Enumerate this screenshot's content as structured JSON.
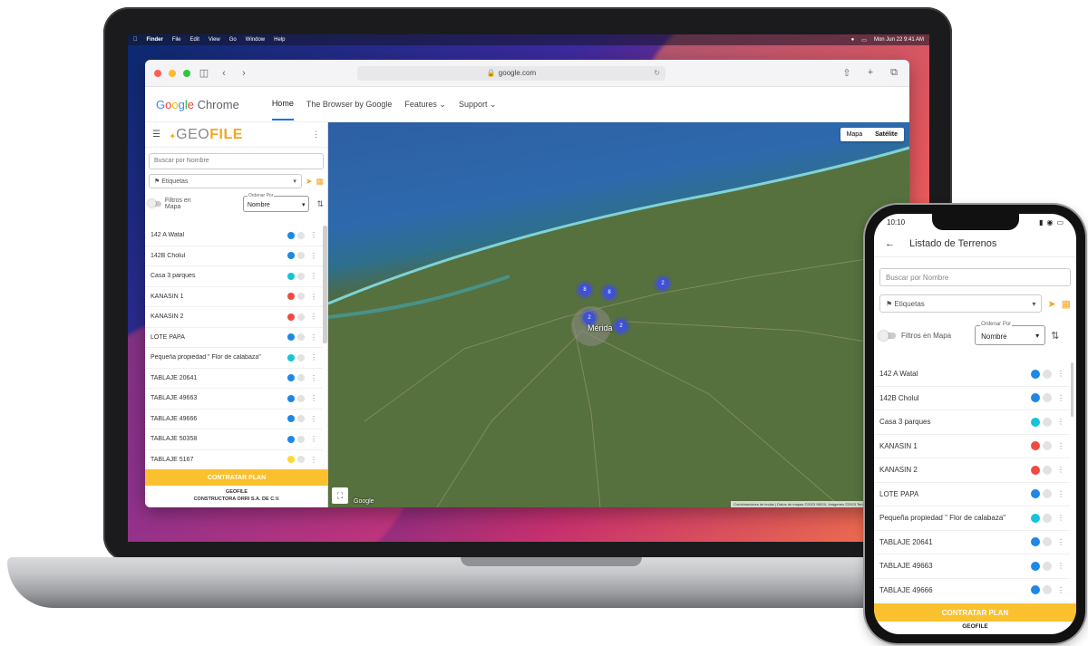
{
  "colors": {
    "accent_orange": "#f5a623",
    "plan_yellow": "#fbc02d",
    "dot_blue": "#1e88e5",
    "dot_cyan": "#17c3d6",
    "dot_red": "#ef4b43",
    "dot_yellow": "#fdd835"
  },
  "menubar": {
    "items": [
      "Finder",
      "File",
      "Edit",
      "View",
      "Go",
      "Window",
      "Help"
    ],
    "clock": "Mon Jun 22 9:41 AM"
  },
  "browser": {
    "url": "google.com"
  },
  "site": {
    "logo": {
      "g": "G",
      "o1": "o",
      "o2": "o",
      "g2": "g",
      "l": "l",
      "e": "e",
      "rest": " Chrome"
    },
    "nav": [
      "Home",
      "The Browser by Google",
      "Features",
      "Support"
    ]
  },
  "geofile": {
    "logo_prefix": "GEO",
    "logo_suffix": "FILE",
    "search_placeholder": "Buscar por Nombre",
    "tags_label": "Etiquetas",
    "filters_label": "Filtros en Mapa",
    "order_label": "Ordenar Por",
    "order_value": "Nombre",
    "items": [
      {
        "name": "142 A Watal",
        "color": "#1e88e5"
      },
      {
        "name": "142B Cholul",
        "color": "#1e88e5"
      },
      {
        "name": "Casa 3 parques",
        "color": "#17c3d6"
      },
      {
        "name": "KANASIN 1",
        "color": "#ef4b43"
      },
      {
        "name": "KANASIN 2",
        "color": "#ef4b43"
      },
      {
        "name": "LOTE PAPA",
        "color": "#1e88e5"
      },
      {
        "name": "Pequeña propiedad \" Flor de calabaza\"",
        "color": "#17c3d6"
      },
      {
        "name": "TABLAJE 20641",
        "color": "#1e88e5"
      },
      {
        "name": "TABLAJE 49663",
        "color": "#1e88e5"
      },
      {
        "name": "TABLAJE 49666",
        "color": "#1e88e5"
      },
      {
        "name": "TABLAJE 50358",
        "color": "#1e88e5"
      },
      {
        "name": "TABLAJE 5167",
        "color": "#fdd835"
      }
    ],
    "plan_button": "CONTRATAR PLAN",
    "footer_line1": "GEOFILE",
    "footer_line2": "CONSTRUCTORA ORRI S.A. DE C.V."
  },
  "map": {
    "type_map": "Mapa",
    "type_satellite": "Satélite",
    "city": "Mérida",
    "clusters": [
      "8",
      "8",
      "2",
      "2",
      "2"
    ],
    "attribution": "Combinaciones de teclas | Datos de mapas ©2023 INEGI, Imágenes ©2023 TerraMetrics | Términos de uso",
    "google_label": "Google"
  },
  "phone": {
    "time": "10:10",
    "title": "Listado de Terrenos",
    "search_placeholder": "Buscar por Nombre",
    "tags_label": "Etiquetas",
    "filters_label": "Filtros en Mapa",
    "order_label": "Ordenar Por",
    "order_value": "Nombre",
    "items": [
      {
        "name": "142 A Watal",
        "color": "#1e88e5"
      },
      {
        "name": "142B Cholul",
        "color": "#1e88e5"
      },
      {
        "name": "Casa 3 parques",
        "color": "#17c3d6"
      },
      {
        "name": "KANASIN 1",
        "color": "#ef4b43"
      },
      {
        "name": "KANASIN 2",
        "color": "#ef4b43"
      },
      {
        "name": "LOTE PAPA",
        "color": "#1e88e5"
      },
      {
        "name": "Pequeña propiedad \" Flor de calabaza\"",
        "color": "#17c3d6"
      },
      {
        "name": "TABLAJE 20641",
        "color": "#1e88e5"
      },
      {
        "name": "TABLAJE 49663",
        "color": "#1e88e5"
      },
      {
        "name": "TABLAJE 49666",
        "color": "#1e88e5"
      }
    ],
    "plan_button": "CONTRATAR PLAN",
    "footer": "GEOFILE"
  }
}
